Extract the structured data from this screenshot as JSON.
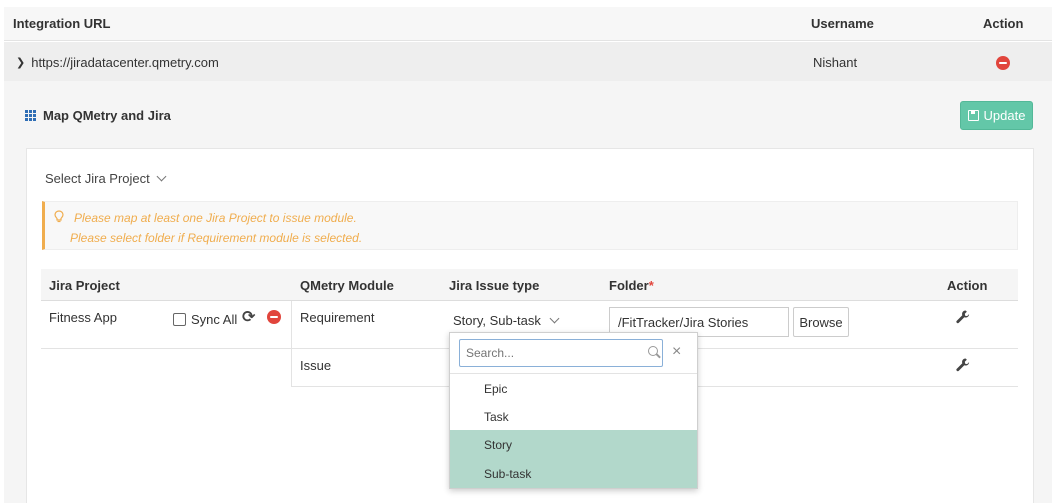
{
  "integrations": {
    "headers": {
      "url": "Integration URL",
      "username": "Username",
      "action": "Action"
    },
    "row": {
      "url": "https://jiradatacenter.qmetry.com",
      "username": "Nishant"
    }
  },
  "mapping": {
    "title": "Map QMetry and Jira",
    "update_label": "Update",
    "select_project_label": "Select Jira Project",
    "alert": {
      "line1": "Please map at least one Jira Project to issue module.",
      "line2": "Please select folder if Requirement module is selected."
    },
    "table": {
      "headers": {
        "project": "Jira Project",
        "module": "QMetry Module",
        "issue_type": "Jira Issue type",
        "folder": "Folder",
        "required_mark": "*",
        "action": "Action"
      },
      "project_name": "Fitness App",
      "sync_all_label": "Sync All",
      "rows": [
        {
          "module": "Requirement",
          "issue_type": "Story, Sub-task",
          "folder": "/FitTracker/Jira Stories",
          "browse_label": "Browse"
        },
        {
          "module": "Issue"
        }
      ]
    }
  },
  "dropdown": {
    "search_placeholder": "Search...",
    "close_glyph": "×",
    "items": [
      {
        "label": "Epic",
        "selected": false
      },
      {
        "label": "Task",
        "selected": false
      },
      {
        "label": "Story",
        "selected": true
      },
      {
        "label": "Sub-task",
        "selected": true
      }
    ]
  },
  "colors": {
    "accent": "#63c7a8",
    "selected_option": "#b2d8cb",
    "alert_text": "#f0ad4e",
    "remove": "#e1453c"
  }
}
